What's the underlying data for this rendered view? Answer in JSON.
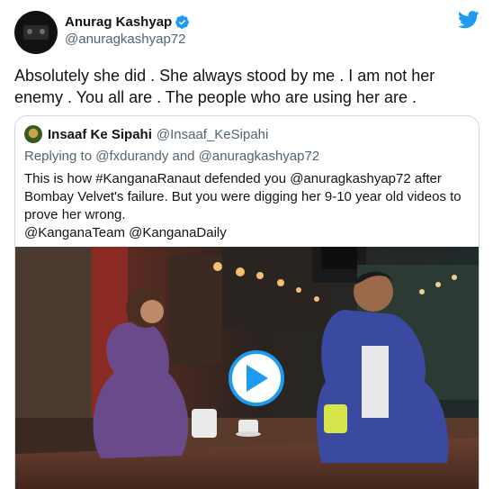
{
  "author": {
    "display_name": "Anurag Kashyap",
    "handle": "@anuragkashyap72",
    "verified": true,
    "avatar_icon": "avatar-icon"
  },
  "tweet": {
    "text": "Absolutely she did . She always stood by me . I am not her enemy . You all are . The people who are using her are ."
  },
  "quoted_tweet": {
    "display_name": "Insaaf Ke Sipahi",
    "handle": "@Insaaf_KeSipahi",
    "replying_to": "Replying to @fxdurandy and @anuragkashyap72",
    "text_line1": "This is how #KanganaRanaut defended you @anuragkashyap72 after",
    "text_line2": "Bombay Velvet's failure. But you were digging her 9-10 year old videos to",
    "text_line3": "prove her wrong.",
    "text_line4": "@KanganaTeam @KanganaDaily"
  },
  "media": {
    "type": "video",
    "play_icon": "play-icon"
  },
  "colors": {
    "brand_blue": "#1d9bf0",
    "text_primary": "#0f1419",
    "text_secondary": "#536471",
    "border": "#cfd9de"
  }
}
